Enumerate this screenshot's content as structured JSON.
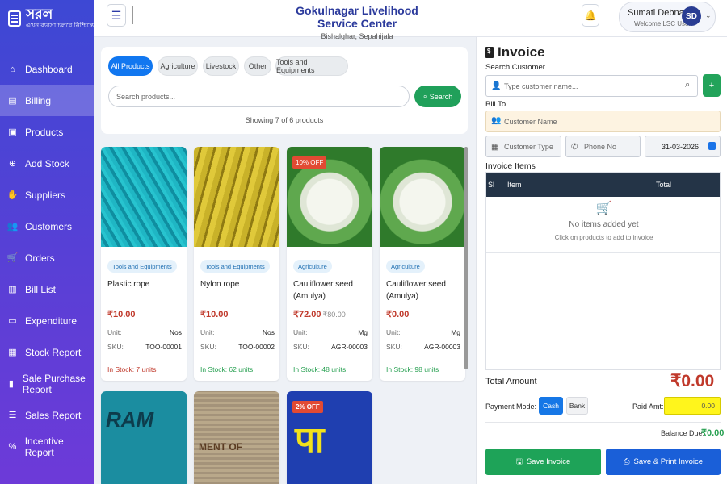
{
  "brand": {
    "name": "সরল",
    "tagline": "এখন ব্যবসা চলবে নিশ্চিন্তে"
  },
  "sidebar": {
    "items": [
      {
        "label": "Dashboard",
        "icon": "home-icon",
        "glyph": "⌂"
      },
      {
        "label": "Billing",
        "icon": "billing-icon",
        "glyph": "▤"
      },
      {
        "label": "Products",
        "icon": "box-icon",
        "glyph": "▣"
      },
      {
        "label": "Add Stock",
        "icon": "plus-circle-icon",
        "glyph": "⊕"
      },
      {
        "label": "Suppliers",
        "icon": "hand-icon",
        "glyph": "✋"
      },
      {
        "label": "Customers",
        "icon": "users-icon",
        "glyph": "👥"
      },
      {
        "label": "Orders",
        "icon": "cart-icon",
        "glyph": "🛒"
      },
      {
        "label": "Bill List",
        "icon": "receipt-icon",
        "glyph": "▥"
      },
      {
        "label": "Expenditure",
        "icon": "wallet-icon",
        "glyph": "▭"
      },
      {
        "label": "Stock Report",
        "icon": "boxes-icon",
        "glyph": "▦"
      },
      {
        "label": "Sale Purchase Report",
        "icon": "chart-icon",
        "glyph": "▮"
      },
      {
        "label": "Sales Report",
        "icon": "list-icon",
        "glyph": "☰"
      },
      {
        "label": "Incentive Report",
        "icon": "percent-icon",
        "glyph": "%"
      }
    ]
  },
  "header": {
    "title": "Gokulnagar Livelihood Service Center",
    "subtitle": "Bishalghar, Sepahijala",
    "user": {
      "name": "Sumati Debnath",
      "role": "Welcome LSC User",
      "initials": "SD"
    }
  },
  "filters": {
    "chips": [
      "All Products",
      "Agriculture",
      "Livestock",
      "Other",
      "Tools and Equipments"
    ],
    "search_placeholder": "Search products...",
    "search_button": "Search",
    "showing": "Showing 7 of 6 products"
  },
  "products": [
    {
      "category": "Tools and Equipments",
      "name": "Plastic rope",
      "price": "₹10.00",
      "mrp": "",
      "unit_label": "Unit:",
      "unit": "Nos",
      "sku_label": "SKU:",
      "sku": "TOO-00001",
      "stock": "In Stock: 7 units",
      "stock_status": "low",
      "badge": ""
    },
    {
      "category": "Tools and Equipments",
      "name": "Nylon rope",
      "price": "₹10.00",
      "mrp": "",
      "unit_label": "Unit:",
      "unit": "Nos",
      "sku_label": "SKU:",
      "sku": "TOO-00002",
      "stock": "In Stock: 62 units",
      "stock_status": "ok",
      "badge": ""
    },
    {
      "category": "Agriculture",
      "name": "Cauliflower seed (Amulya)",
      "price": "₹72.00",
      "mrp": "₹80.00",
      "unit_label": "Unit:",
      "unit": "Mg",
      "sku_label": "SKU:",
      "sku": "AGR-00003",
      "stock": "In Stock: 48 units",
      "stock_status": "ok",
      "badge": "10% OFF"
    },
    {
      "category": "Agriculture",
      "name": "Cauliflower seed (Amulya)",
      "price": "₹0.00",
      "mrp": "",
      "unit_label": "Unit:",
      "unit": "Mg",
      "sku_label": "SKU:",
      "sku": "AGR-00003",
      "stock": "In Stock: 98 units",
      "stock_status": "ok",
      "badge": ""
    }
  ],
  "partial_products": [
    {
      "badge": "",
      "img_text": "RAM"
    },
    {
      "badge": "",
      "img_text": "MENT OF"
    },
    {
      "badge": "2% OFF",
      "img_text": "पा"
    }
  ],
  "invoice": {
    "title": "Invoice",
    "search_customer_label": "Search Customer",
    "customer_search_placeholder": "Type customer name...",
    "bill_to_label": "Bill To",
    "customer_name_placeholder": "Customer Name",
    "customer_type_placeholder": "Customer Type",
    "phone_placeholder": "Phone No",
    "date": "31-03-2026",
    "items_label": "Invoice Items",
    "columns": [
      "Sl",
      "Item",
      "Total"
    ],
    "empty_title": "No items added yet",
    "empty_hint": "Click on products to add to invoice",
    "total_label": "Total Amount",
    "total_value": "₹0.00",
    "payment_mode_label": "Payment Mode:",
    "payment_modes": [
      "Cash",
      "Bank"
    ],
    "paid_label": "Paid Amt:",
    "paid_value": "0.00",
    "balance_label": "Balance Due:",
    "balance_value": "₹0.00",
    "save_button": "Save Invoice",
    "save_print_button": "Save & Print Invoice"
  },
  "colors": {
    "accent": "#1177f0",
    "success": "#1ea358",
    "danger": "#c0392b",
    "sidebar": "#4a46d6"
  }
}
